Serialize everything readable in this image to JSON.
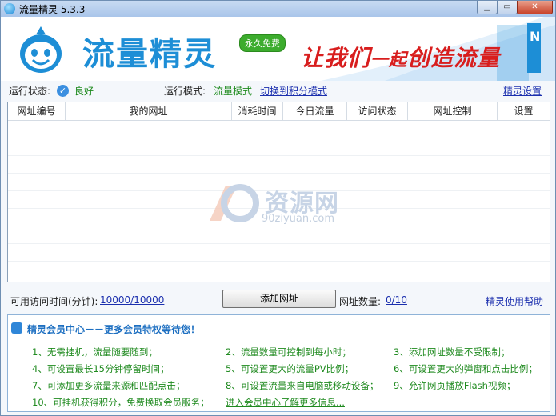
{
  "window": {
    "title": "流量精灵 5.3.3"
  },
  "banner": {
    "logo": "流量精灵",
    "badge": "永久免费",
    "slogan_1": "让我们",
    "slogan_2": "一起",
    "slogan_3": "创造流量"
  },
  "status": {
    "run_status_label": "运行状态:",
    "run_status_value": "良好",
    "run_mode_label": "运行模式:",
    "run_mode_value": "流量模式",
    "switch_link": "切换到积分模式",
    "settings_link": "精灵设置"
  },
  "table": {
    "columns": [
      "网址编号",
      "我的网址",
      "消耗时间",
      "今日流量",
      "访问状态",
      "网址控制",
      "设置"
    ]
  },
  "watermark": {
    "text": "资源网",
    "url": "90ziyuan.com"
  },
  "controls": {
    "time_label": "可用访问时间(分钟):",
    "time_value": "10000/10000",
    "add_button": "添加网址",
    "count_label": "网址数量:",
    "count_value": "0/10",
    "help_link": "精灵使用帮助"
  },
  "member": {
    "title": "精灵会员中心－－更多会员特权等待您！",
    "items": [
      "1、无需挂机，流量随要随到；",
      "2、流量数量可控制到每小时；",
      "3、添加网址数量不受限制；",
      "4、可设置最长15分钟停留时间；",
      "5、可设置更大的流量PV比例；",
      "6、可设置更大的弹窗和点击比例；",
      "7、可添加更多流量来源和匹配点击；",
      "8、可设置流量来自电脑或移动设备；",
      "9、允许网页播放Flash视频；",
      "10、可挂机获得积分，免费换取会员服务；"
    ],
    "more_link": "进入会员中心了解更多信息..."
  },
  "colors": {
    "accent": "#1d8ed6",
    "slogan": "#d81e1e",
    "green": "#1d8a1d",
    "link": "#1b2fae"
  }
}
